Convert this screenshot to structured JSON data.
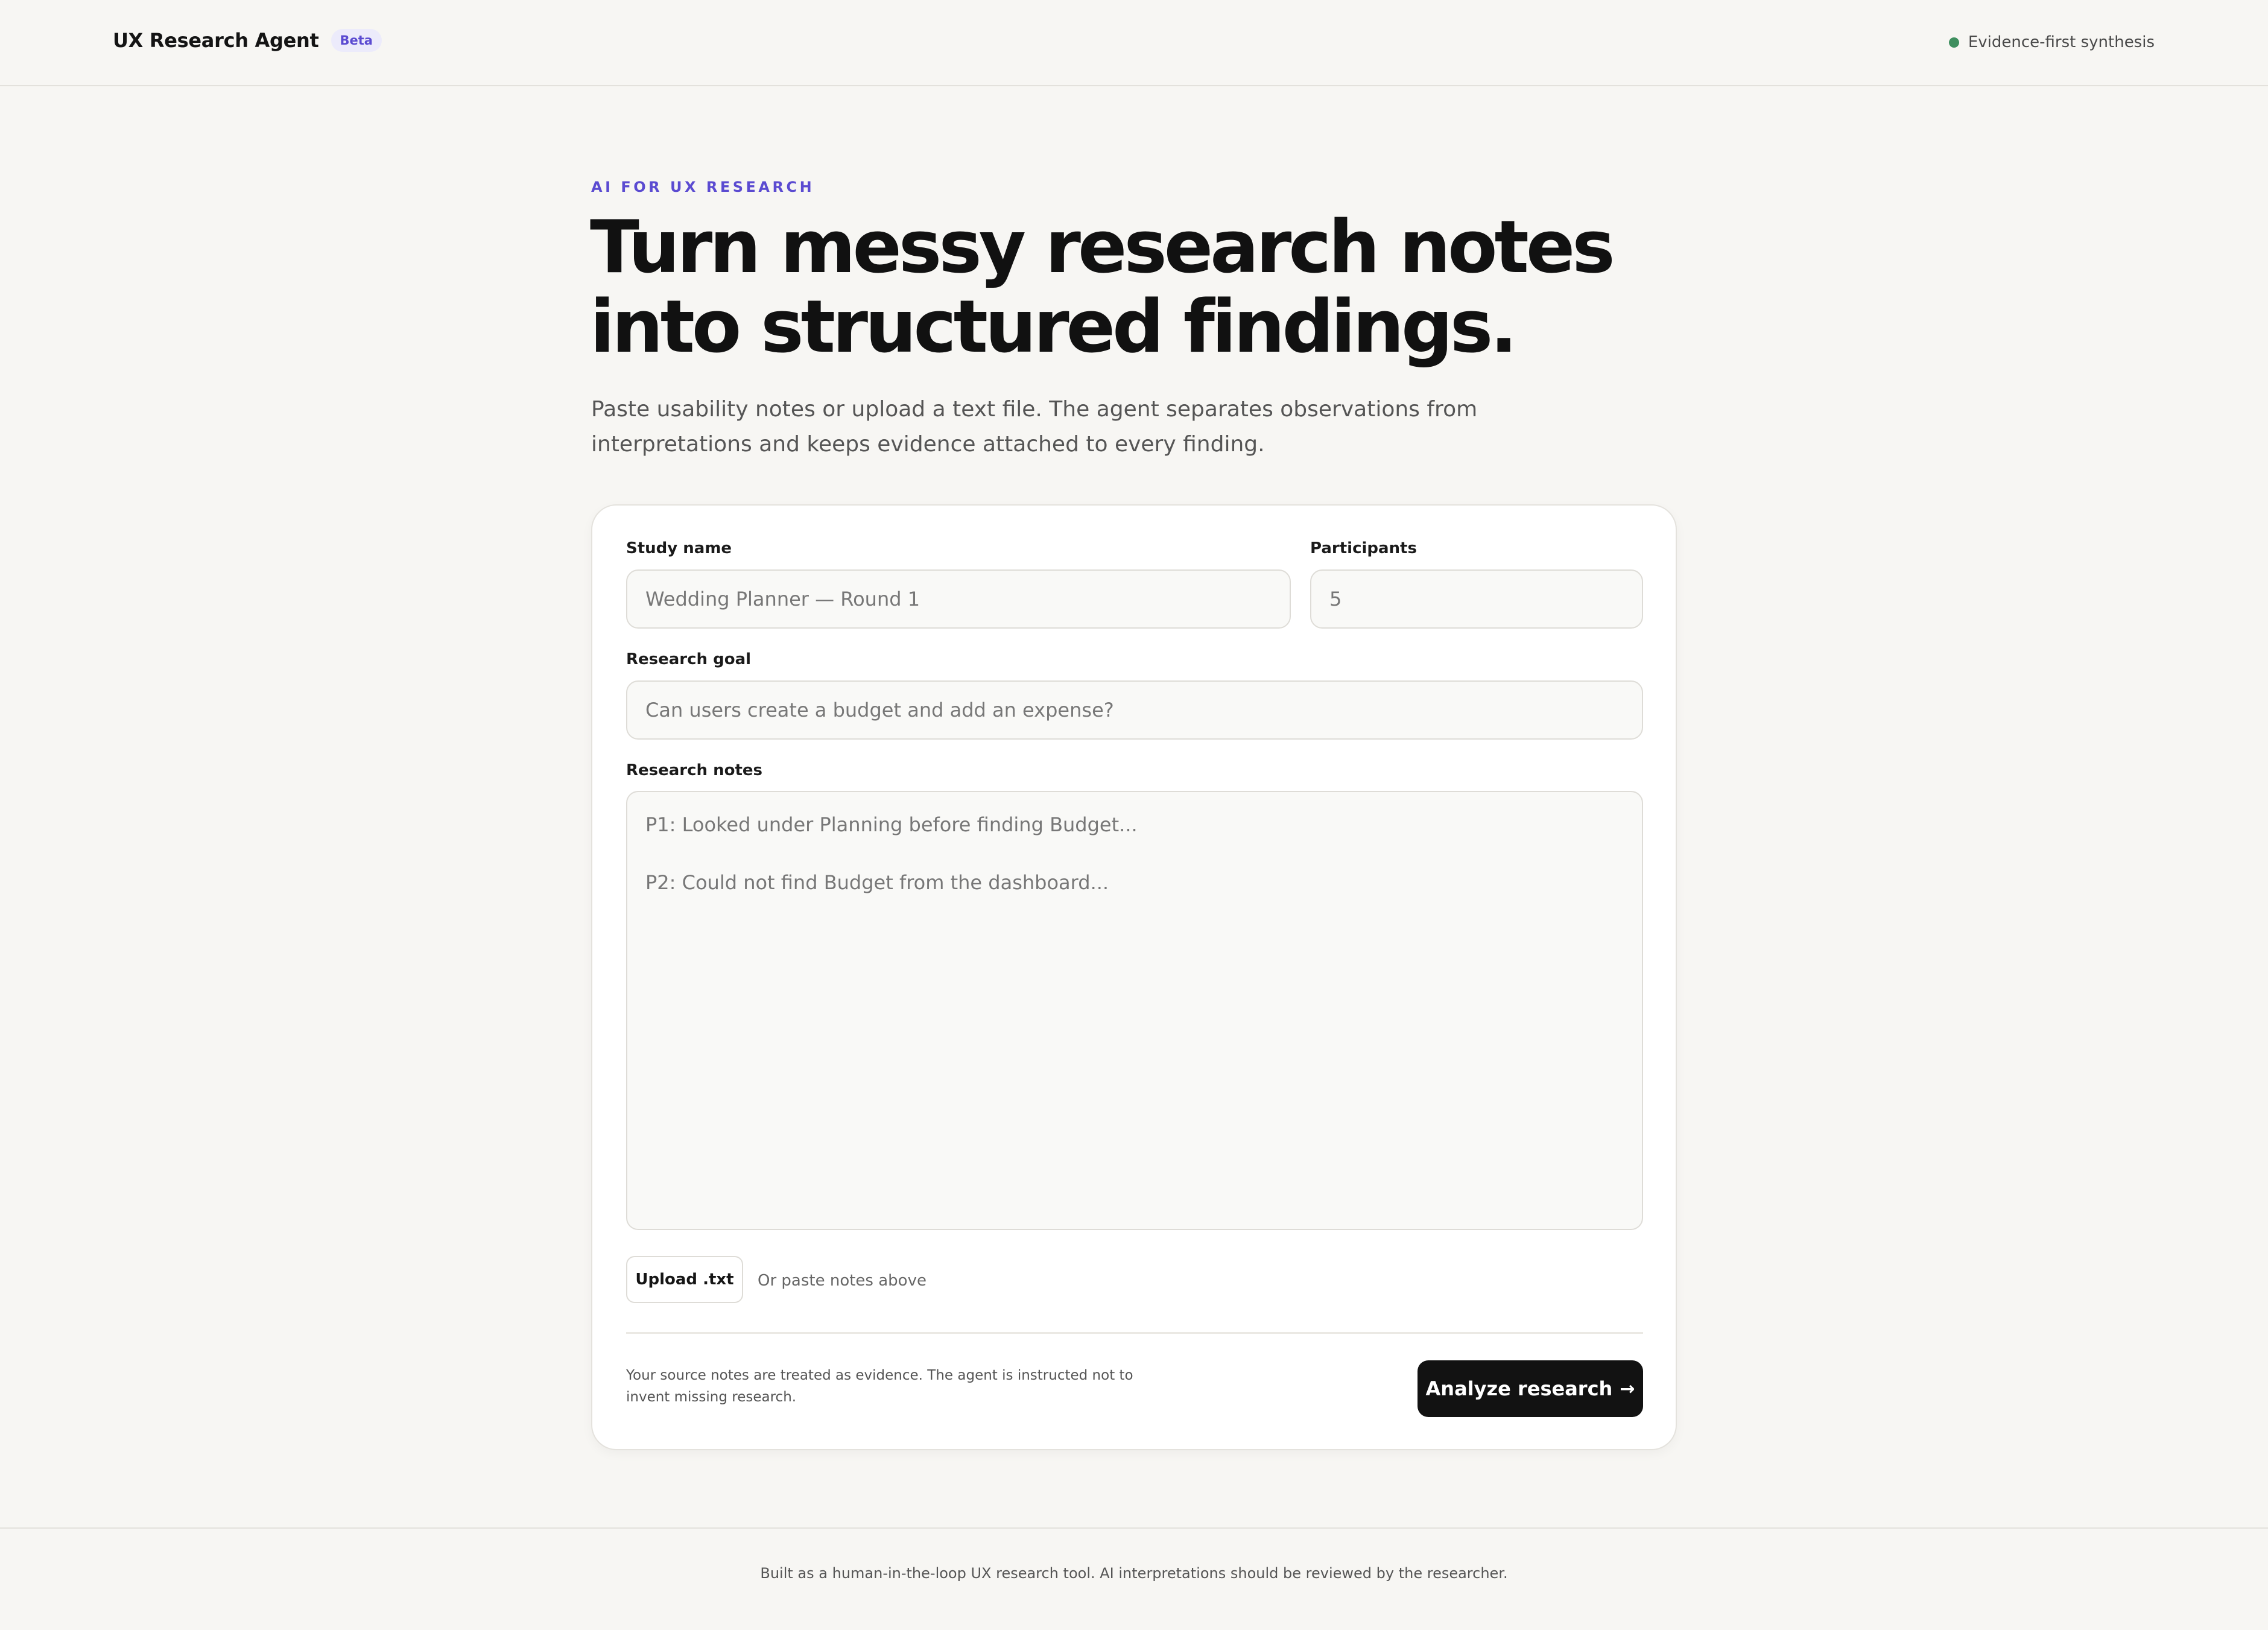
{
  "header": {
    "brand": "UX Research Agent",
    "badge": "Beta",
    "status": "Evidence-first synthesis"
  },
  "hero": {
    "eyebrow": "AI FOR UX RESEARCH",
    "headline_line1": "Turn messy research notes",
    "headline_line2": "into structured findings.",
    "lede_line1": "Paste usability notes or upload a text file. The agent separates observations from",
    "lede_line2": "interpretations and keeps evidence attached to every finding."
  },
  "form": {
    "study_name_label": "Study name",
    "study_name_placeholder": "Wedding Planner — Round 1",
    "participants_label": "Participants",
    "participants_placeholder": "5",
    "goal_label": "Research goal",
    "goal_placeholder": "Can users create a budget and add an expense?",
    "notes_label": "Research notes",
    "notes_placeholder_line1": "P1: Looked under Planning before finding Budget...",
    "notes_placeholder_line2": "P2: Could not find Budget from the dashboard...",
    "upload_label": "Upload .txt",
    "upload_hint": "Or paste notes above",
    "disclaimer_line1": "Your source notes are treated as evidence. The agent is instructed not to",
    "disclaimer_line2": "invent missing research.",
    "submit_label": "Analyze research",
    "submit_arrow": "→"
  },
  "footer": {
    "text": "Built as a human-in-the-loop UX research tool. AI interpretations should be reviewed by the researcher."
  },
  "colors": {
    "accent": "#5b4bd1",
    "status_dot": "#3f8f5f",
    "button_bg": "#121212",
    "page_bg": "#f7f6f3"
  }
}
